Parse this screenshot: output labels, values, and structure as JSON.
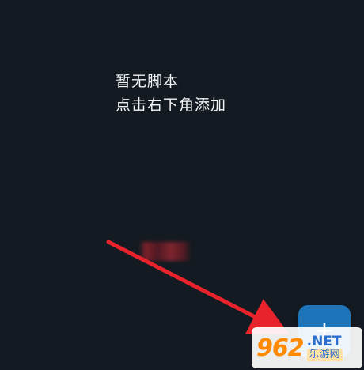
{
  "empty_state": {
    "line1": "暂无脚本",
    "line2": "点击右下角添加"
  },
  "fab": {
    "label": "+"
  },
  "watermark": {
    "number": "962",
    "suffix": ".NET",
    "site": "乐游网"
  },
  "colors": {
    "background": "#141a21",
    "fab": "#1e74b9",
    "arrow": "#e8232b"
  },
  "icons": {
    "fab": "plus-icon",
    "annotation": "arrow-icon"
  }
}
